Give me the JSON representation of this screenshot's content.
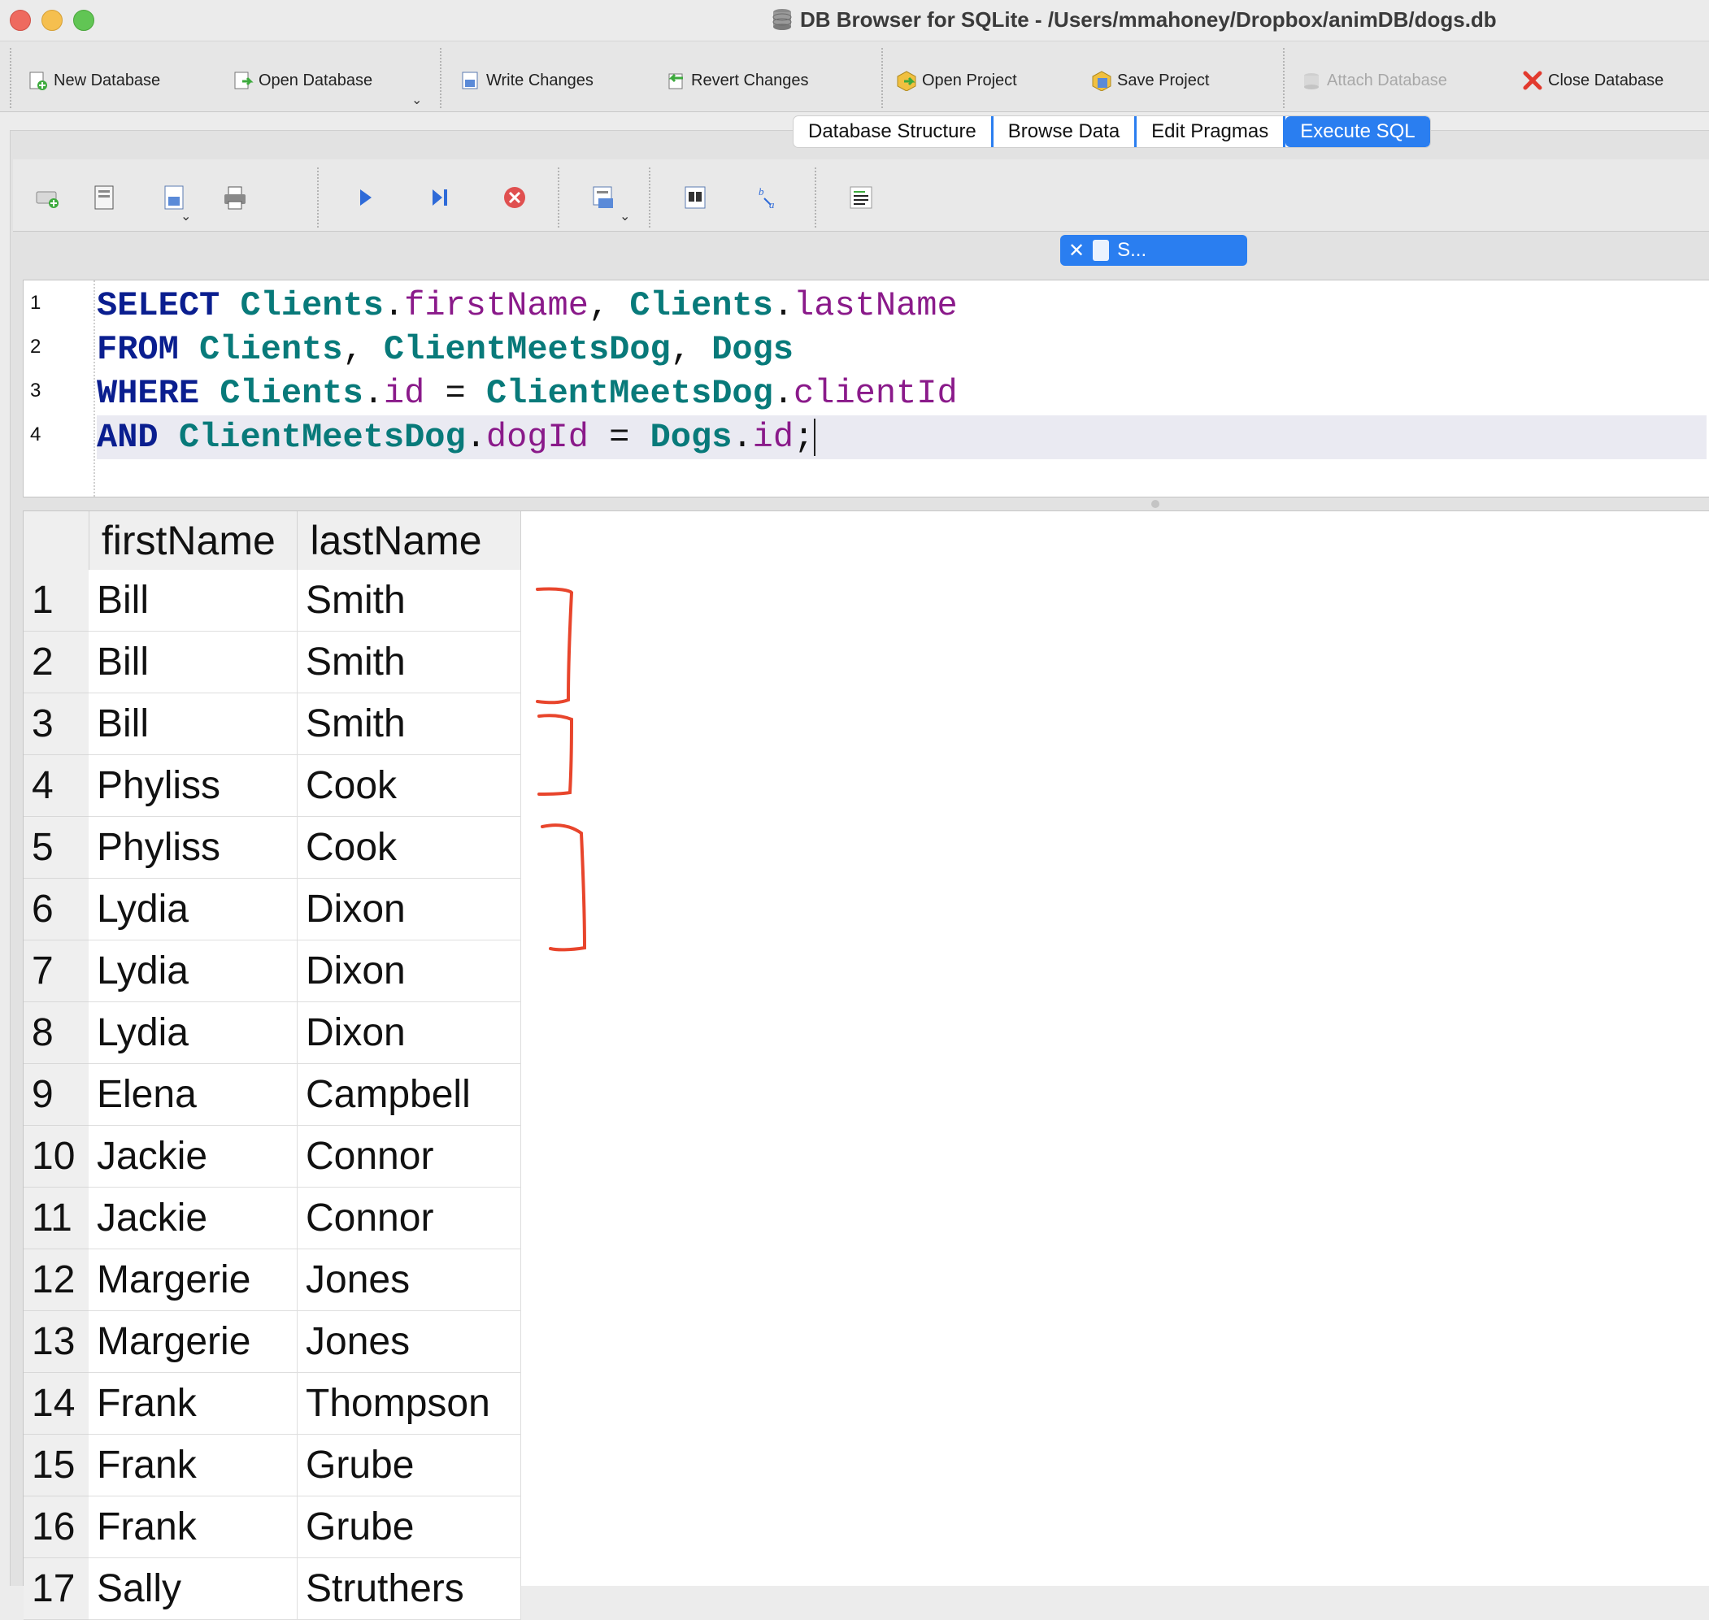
{
  "window": {
    "title": "DB Browser for SQLite - /Users/mmahoney/Dropbox/animDB/dogs.db"
  },
  "main_toolbar": {
    "new_database": "New Database",
    "open_database": "Open Database",
    "write_changes": "Write Changes",
    "revert_changes": "Revert Changes",
    "open_project": "Open Project",
    "save_project": "Save Project",
    "attach_database": "Attach Database",
    "close_database": "Close Database"
  },
  "tabs": [
    {
      "label": "Database Structure",
      "active": false
    },
    {
      "label": "Browse Data",
      "active": false
    },
    {
      "label": "Edit Pragmas",
      "active": false
    },
    {
      "label": "Execute SQL",
      "active": true
    }
  ],
  "sql_tab": {
    "label": "S..."
  },
  "editor": {
    "line_numbers": [
      "1",
      "2",
      "3",
      "4"
    ],
    "lines": [
      [
        {
          "t": "SELECT",
          "c": "kw"
        },
        {
          "t": " ",
          "c": "pn"
        },
        {
          "t": "Clients",
          "c": "tbl"
        },
        {
          "t": ".",
          "c": "pn"
        },
        {
          "t": "firstName",
          "c": "col"
        },
        {
          "t": ", ",
          "c": "pn"
        },
        {
          "t": "Clients",
          "c": "tbl"
        },
        {
          "t": ".",
          "c": "pn"
        },
        {
          "t": "lastName",
          "c": "col"
        }
      ],
      [
        {
          "t": "FROM",
          "c": "kw"
        },
        {
          "t": " ",
          "c": "pn"
        },
        {
          "t": "Clients",
          "c": "tbl"
        },
        {
          "t": ", ",
          "c": "pn"
        },
        {
          "t": "ClientMeetsDog",
          "c": "tbl"
        },
        {
          "t": ", ",
          "c": "pn"
        },
        {
          "t": "Dogs",
          "c": "tbl"
        }
      ],
      [
        {
          "t": "WHERE",
          "c": "kw"
        },
        {
          "t": " ",
          "c": "pn"
        },
        {
          "t": "Clients",
          "c": "tbl"
        },
        {
          "t": ".",
          "c": "pn"
        },
        {
          "t": "id",
          "c": "col"
        },
        {
          "t": " = ",
          "c": "pn"
        },
        {
          "t": "ClientMeetsDog",
          "c": "tbl"
        },
        {
          "t": ".",
          "c": "pn"
        },
        {
          "t": "clientId",
          "c": "col"
        }
      ],
      [
        {
          "t": "AND",
          "c": "kw"
        },
        {
          "t": " ",
          "c": "pn"
        },
        {
          "t": "ClientMeetsDog",
          "c": "tbl"
        },
        {
          "t": ".",
          "c": "pn"
        },
        {
          "t": "dogId",
          "c": "col"
        },
        {
          "t": " = ",
          "c": "pn"
        },
        {
          "t": "Dogs",
          "c": "tbl"
        },
        {
          "t": ".",
          "c": "pn"
        },
        {
          "t": "id",
          "c": "col"
        },
        {
          "t": ";",
          "c": "pn"
        }
      ]
    ]
  },
  "results": {
    "columns": [
      "firstName",
      "lastName"
    ],
    "rows": [
      {
        "n": "1",
        "first": "Bill",
        "last": "Smith"
      },
      {
        "n": "2",
        "first": "Bill",
        "last": "Smith"
      },
      {
        "n": "3",
        "first": "Bill",
        "last": "Smith"
      },
      {
        "n": "4",
        "first": "Phyliss",
        "last": "Cook"
      },
      {
        "n": "5",
        "first": "Phyliss",
        "last": "Cook"
      },
      {
        "n": "6",
        "first": "Lydia",
        "last": "Dixon"
      },
      {
        "n": "7",
        "first": "Lydia",
        "last": "Dixon"
      },
      {
        "n": "8",
        "first": "Lydia",
        "last": "Dixon"
      },
      {
        "n": "9",
        "first": "Elena",
        "last": "Campbell"
      },
      {
        "n": "10",
        "first": "Jackie",
        "last": "Connor"
      },
      {
        "n": "11",
        "first": "Jackie",
        "last": "Connor"
      },
      {
        "n": "12",
        "first": "Margerie",
        "last": "Jones"
      },
      {
        "n": "13",
        "first": "Margerie",
        "last": "Jones"
      },
      {
        "n": "14",
        "first": "Frank",
        "last": "Thompson"
      },
      {
        "n": "15",
        "first": "Frank",
        "last": "Grube"
      },
      {
        "n": "16",
        "first": "Frank",
        "last": "Grube"
      },
      {
        "n": "17",
        "first": "Sally",
        "last": "Struthers"
      }
    ]
  },
  "colors": {
    "accent": "#2a7ef0",
    "keyword": "#0a1e8f",
    "table": "#087a7a",
    "column": "#8a1a8a",
    "annotation": "#e8452c"
  },
  "icons": {
    "sql_toolbar": [
      "open-tab-icon",
      "open-sql-icon",
      "save-sql-icon",
      "print-icon",
      "execute-all-icon",
      "execute-line-icon",
      "stop-execution-icon",
      "save-results-icon",
      "find-icon",
      "find-replace-icon",
      "comment-icon"
    ]
  }
}
